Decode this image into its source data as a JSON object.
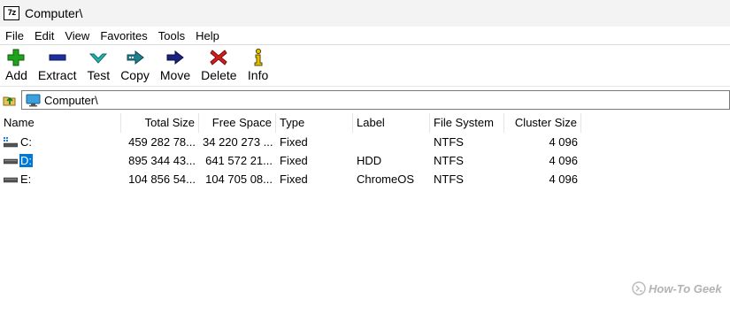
{
  "window": {
    "title": "Computer\\",
    "app_icon_text": "7z"
  },
  "menu": [
    "File",
    "Edit",
    "View",
    "Favorites",
    "Tools",
    "Help"
  ],
  "toolbar": [
    {
      "label": "Add",
      "icon": "add-icon",
      "color": "#1ea31e"
    },
    {
      "label": "Extract",
      "icon": "extract-icon",
      "color": "#1c2f9c"
    },
    {
      "label": "Test",
      "icon": "test-icon",
      "color": "#22b3b3"
    },
    {
      "label": "Copy",
      "icon": "copy-icon",
      "color": "#1f7f8c"
    },
    {
      "label": "Move",
      "icon": "move-icon",
      "color": "#1a237e"
    },
    {
      "label": "Delete",
      "icon": "delete-icon",
      "color": "#d01f1f"
    },
    {
      "label": "Info",
      "icon": "info-icon",
      "color": "#e0c000"
    }
  ],
  "address": {
    "path": "Computer\\"
  },
  "columns": [
    "Name",
    "Total Size",
    "Free Space",
    "Type",
    "Label",
    "File System",
    "Cluster Size"
  ],
  "rows": [
    {
      "name": "C:",
      "total": "459 282 78...",
      "free": "34 220 273 ...",
      "type": "Fixed",
      "label": "",
      "fs": "NTFS",
      "cluster": "4 096",
      "selected": false,
      "icon": "windows-drive-icon"
    },
    {
      "name": "D:",
      "total": "895 344 43...",
      "free": "641 572 21...",
      "type": "Fixed",
      "label": "HDD",
      "fs": "NTFS",
      "cluster": "4 096",
      "selected": true,
      "icon": "drive-icon"
    },
    {
      "name": "E:",
      "total": "104 856 54...",
      "free": "104 705 08...",
      "type": "Fixed",
      "label": "ChromeOS",
      "fs": "NTFS",
      "cluster": "4 096",
      "selected": false,
      "icon": "drive-icon"
    }
  ],
  "watermark": {
    "text": "How-To Geek"
  },
  "colors": {
    "selection": "#0078d7"
  }
}
